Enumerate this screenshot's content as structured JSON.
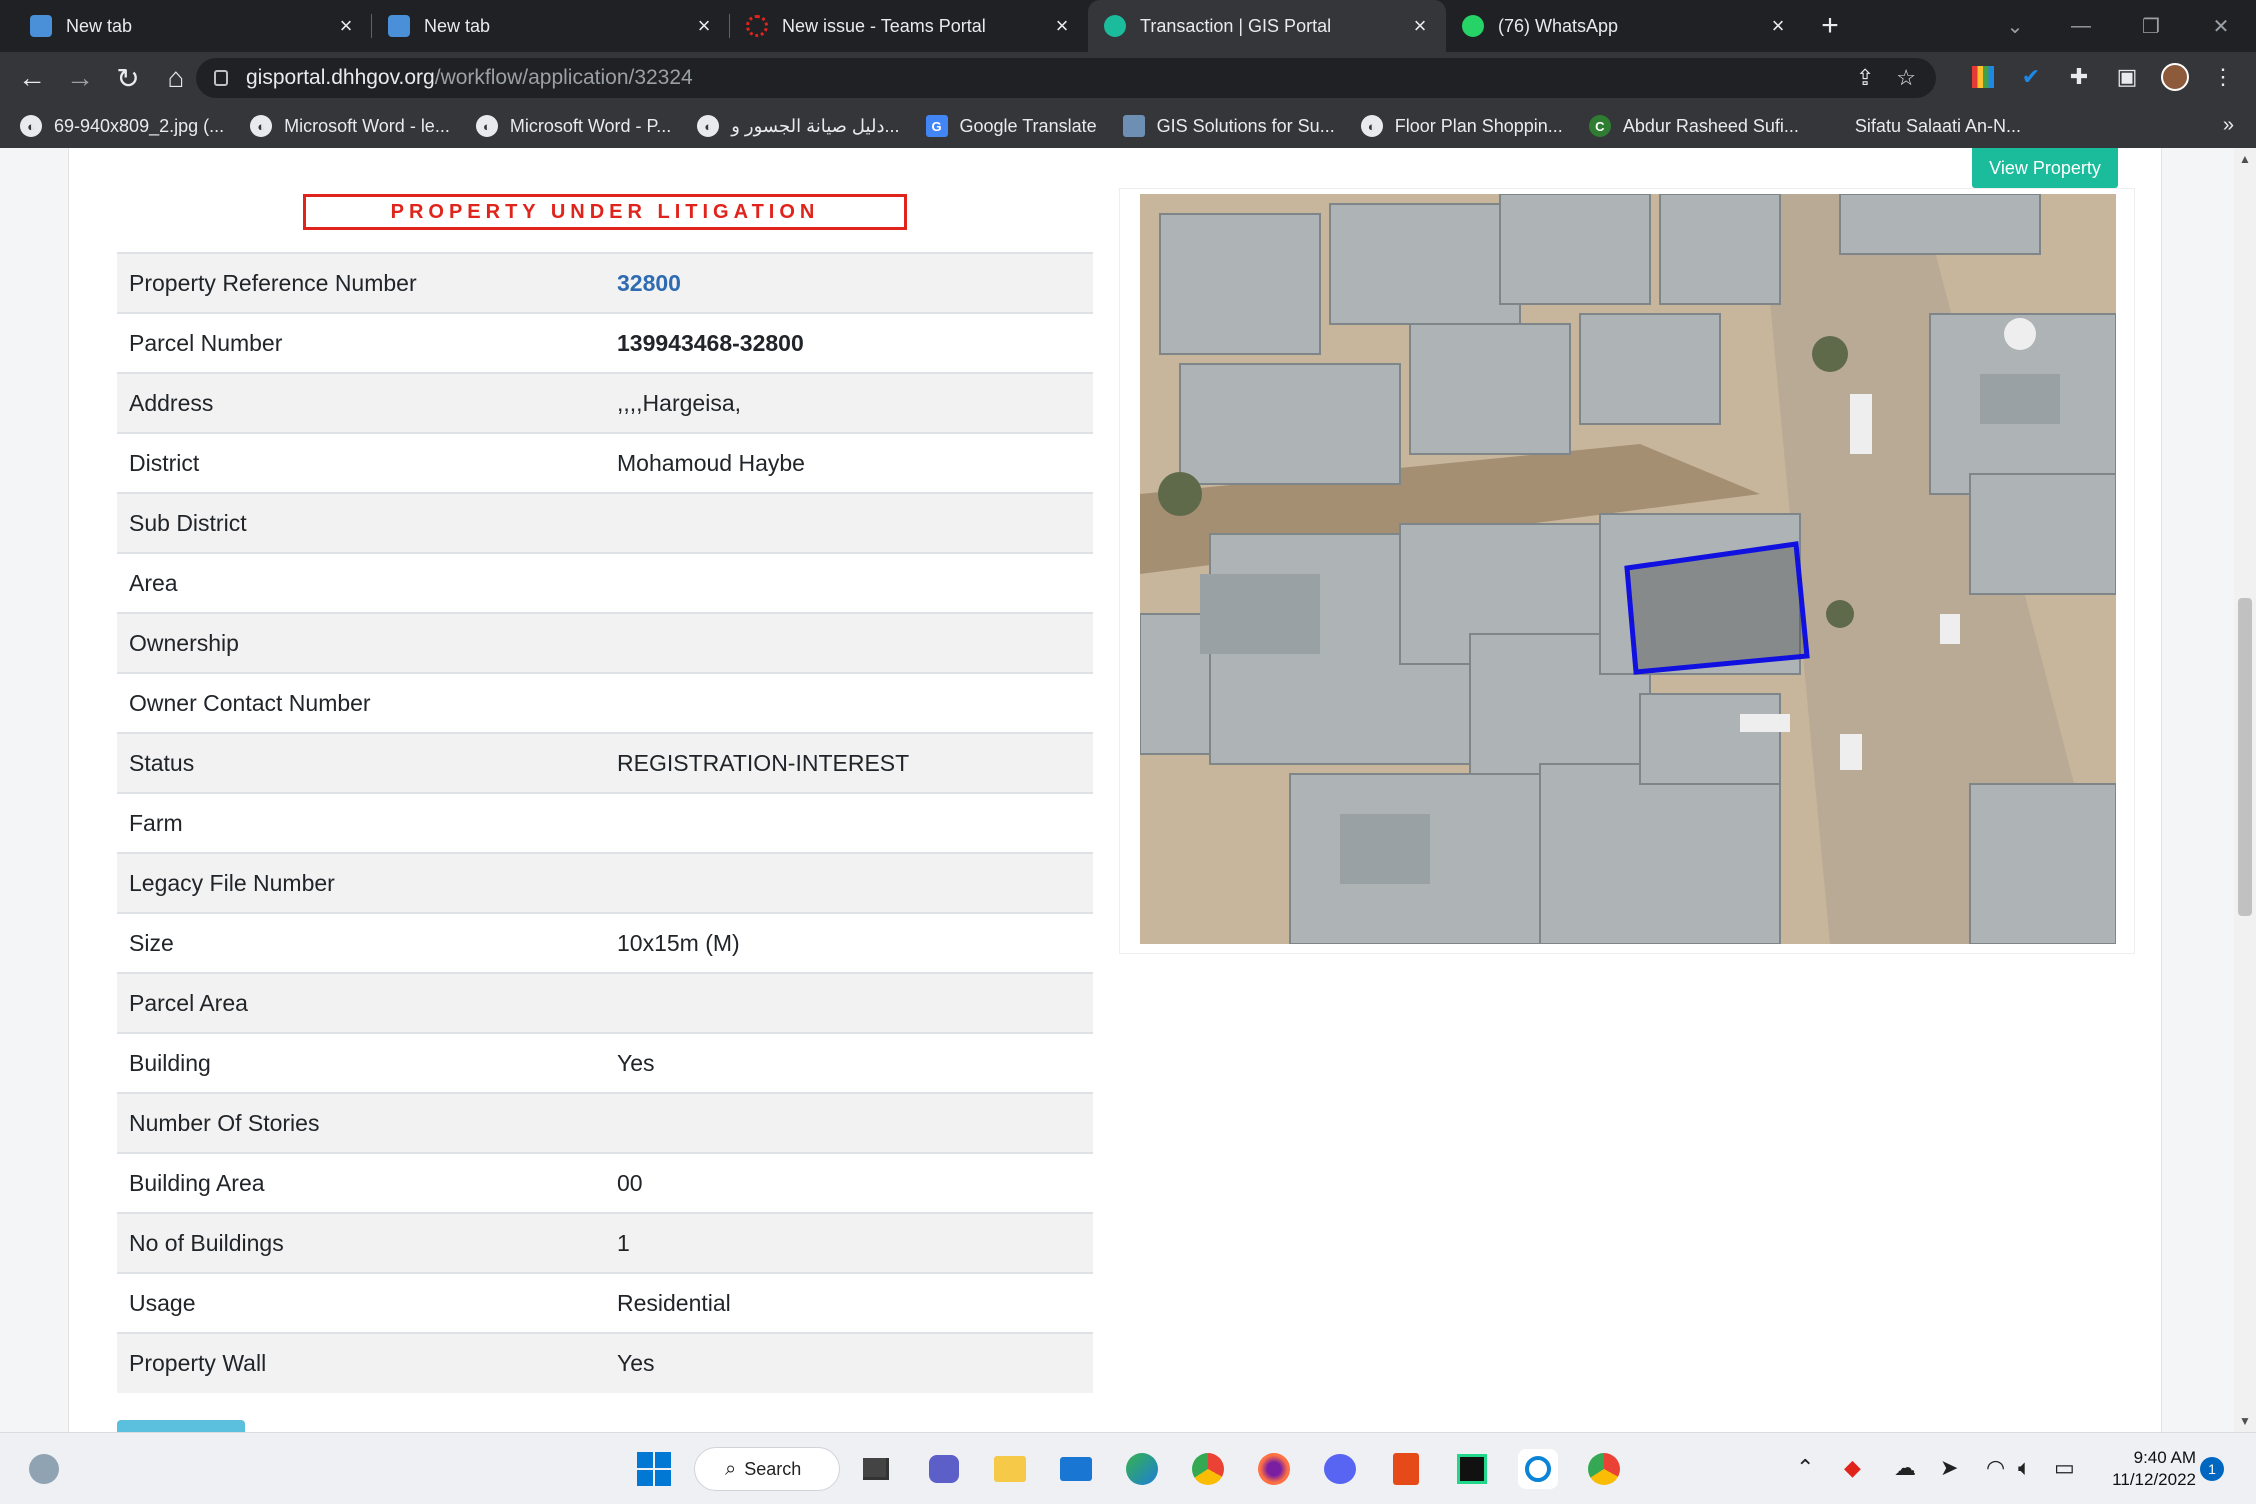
{
  "tabs": [
    {
      "title": "New tab",
      "favicon_color": "#4a90d9",
      "active": false
    },
    {
      "title": "New tab",
      "favicon_color": "#4a90d9",
      "active": false
    },
    {
      "title": "New issue - Teams Portal",
      "favicon_color": "#e0241c",
      "active": false
    },
    {
      "title": "Transaction | GIS Portal",
      "favicon_color": "#1abc9c",
      "active": true
    },
    {
      "title": "(76) WhatsApp",
      "favicon_color": "#25d366",
      "active": false
    }
  ],
  "address_bar": {
    "host": "gisportal.dhhgov.org",
    "path": "/workflow/application/32324"
  },
  "bookmarks": [
    "69-940x809_2.jpg (...",
    "Microsoft Word - le...",
    "Microsoft Word - P...",
    "دليل صيانة الجسور و...",
    "Google Translate",
    "GIS Solutions for Su...",
    "Floor Plan Shoppin...",
    "Abdur Rasheed Sufi...",
    "Sifatu Salaati An-N..."
  ],
  "banner": {
    "text": "PROPERTY UNDER LITIGATION",
    "color": "#e0241c"
  },
  "view_property_label": "View Property",
  "properties": [
    {
      "label": "Property Reference Number",
      "value": "32800"
    },
    {
      "label": "Parcel Number",
      "value": "139943468-32800"
    },
    {
      "label": "Address",
      "value": ",,,,Hargeisa,"
    },
    {
      "label": "District",
      "value": "Mohamoud Haybe"
    },
    {
      "label": "Sub District",
      "value": ""
    },
    {
      "label": "Area",
      "value": ""
    },
    {
      "label": "Ownership",
      "value": ""
    },
    {
      "label": "Owner Contact Number",
      "value": ""
    },
    {
      "label": "Status",
      "value": "REGISTRATION-INTEREST"
    },
    {
      "label": "Farm",
      "value": ""
    },
    {
      "label": "Legacy File Number",
      "value": ""
    },
    {
      "label": "Size",
      "value": "10x15m (M)"
    },
    {
      "label": "Parcel Area",
      "value": ""
    },
    {
      "label": "Building",
      "value": "Yes"
    },
    {
      "label": "Number Of Stories",
      "value": ""
    },
    {
      "label": "Building Area",
      "value": "00"
    },
    {
      "label": "No of Buildings",
      "value": "1"
    },
    {
      "label": "Usage",
      "value": "Residential"
    },
    {
      "label": "Property Wall",
      "value": "Yes"
    }
  ],
  "taskbar": {
    "search_label": "Search",
    "time": "9:40 AM",
    "date": "11/12/2022",
    "notification_count": "1"
  },
  "colors": {
    "accent": "#1abc9c",
    "link": "#2f6bb3",
    "parcel_outline": "#1010e0"
  }
}
